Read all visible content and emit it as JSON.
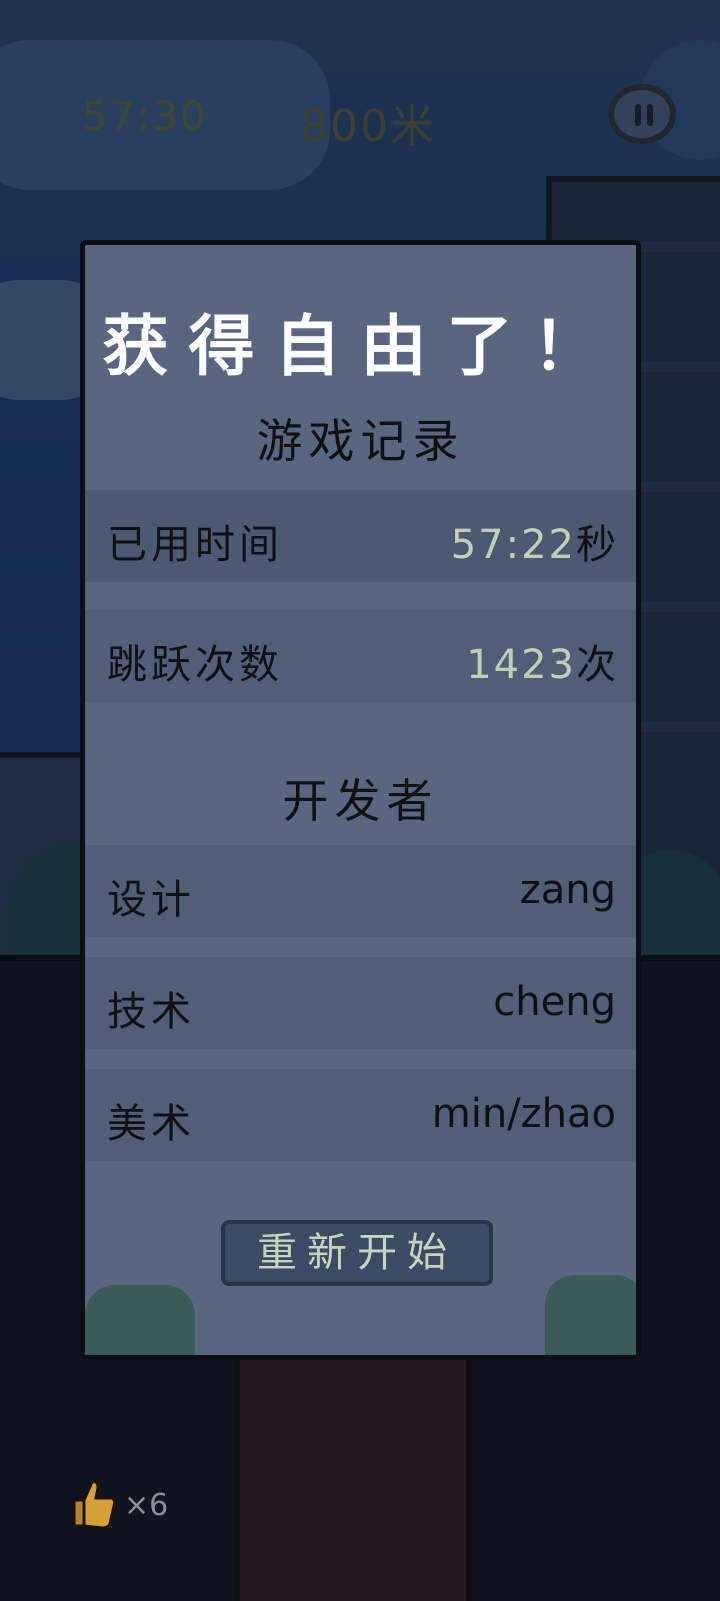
{
  "hud": {
    "time": "57:30",
    "distance": "800米"
  },
  "dialog": {
    "title": "获得自由了！",
    "records_heading": "游戏记录",
    "time_used": {
      "label": "已用时间",
      "value": "57:22",
      "unit": "秒"
    },
    "jumps": {
      "label": "跳跃次数",
      "value": "1423",
      "unit": "次"
    },
    "developers_heading": "开发者",
    "credits": [
      {
        "role": "设计",
        "name": "zang"
      },
      {
        "role": "技术",
        "name": "cheng"
      },
      {
        "role": "美术",
        "name": "min/zhao"
      }
    ],
    "restart_label": "重新开始"
  },
  "lives": {
    "count": "×6"
  },
  "colors": {
    "panel": "#5a6680",
    "row": "#525d77",
    "value_green": "#c3cfb5",
    "button": "#3d4a63"
  }
}
